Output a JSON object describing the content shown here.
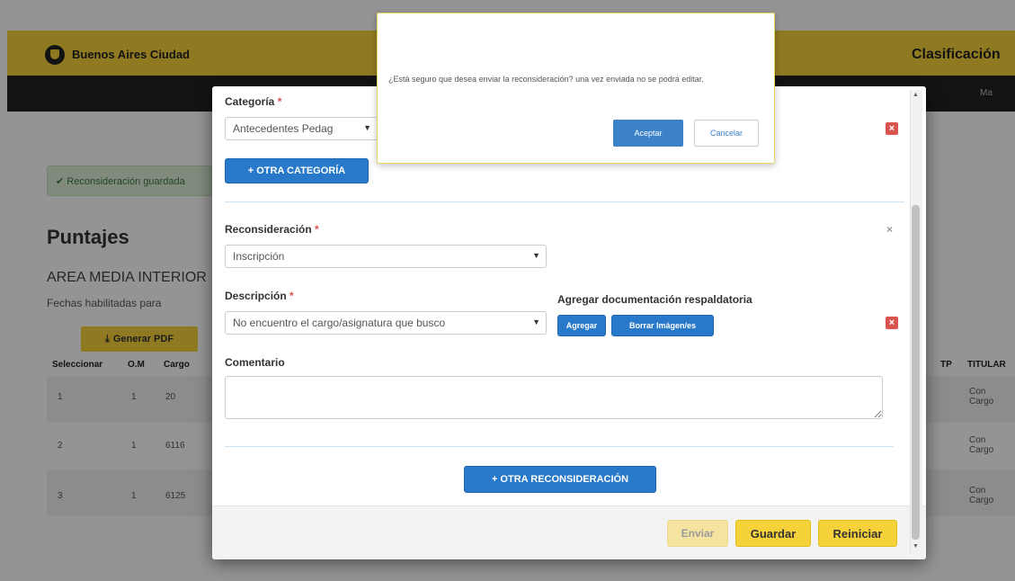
{
  "header": {
    "logo_text": "Buenos Aires Ciudad",
    "section_title": "Clasificación",
    "nav_item": "Ma"
  },
  "page": {
    "alert": "Reconsideración guardada",
    "title": "Puntajes",
    "area": "AREA MEDIA INTERIOR",
    "fechas": "Fechas habilitadas para",
    "pdf_button": "Generar PDF",
    "table_headers": [
      "Seleccionar",
      "O.M",
      "Cargo",
      "TP",
      "TITULAR"
    ],
    "rows": [
      {
        "select": "1",
        "om": "1",
        "cargo": "20",
        "titular": "Con Cargo"
      },
      {
        "select": "2",
        "om": "1",
        "cargo": "6116",
        "titular": "Con Cargo"
      },
      {
        "select": "3",
        "om": "1",
        "cargo": "6125",
        "titular": "Con Cargo"
      }
    ]
  },
  "modal": {
    "categoria_label": "Categoría",
    "categoria_value": "Antecedentes Pedag",
    "otra_categoria": "+ OTRA CATEGORÍA",
    "reconsideracion_label": "Reconsideración",
    "reconsideracion_value": "Inscripción",
    "descripcion_label": "Descripción",
    "descripcion_value": "No encuentro el cargo/asignatura que busco",
    "doc_label": "Agregar documentación respaldatoria",
    "agregar": "Agregar",
    "borrar": "Borrar Imágen/es",
    "comentario_label": "Comentario",
    "comentario_value": "",
    "otra_reconsideracion": "+ OTRA RECONSIDERACIÓN",
    "enviar": "Enviar",
    "guardar": "Guardar",
    "reiniciar": "Reiniciar",
    "required_mark": "*"
  },
  "confirm": {
    "message": "¿Está seguro que desea enviar la reconsideración? una vez enviada no se podrá editar.",
    "aceptar": "Aceptar",
    "cancelar": "Cancelar"
  },
  "colors": {
    "brand_yellow": "#f6d23a",
    "primary_blue": "#2879c9",
    "danger_red": "#d9534f"
  }
}
